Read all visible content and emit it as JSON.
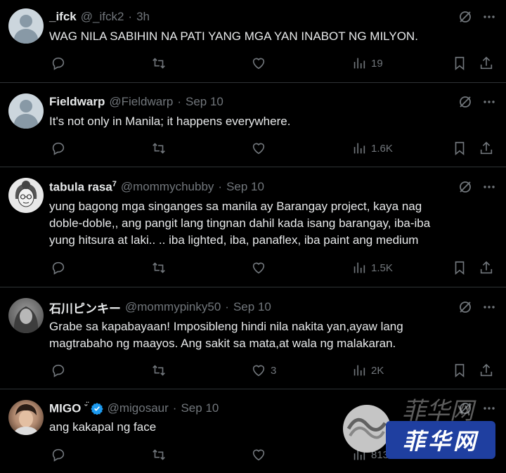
{
  "tweets": [
    {
      "name": "_ifck",
      "name_sup": "",
      "handle": "@_ifck2",
      "time": "3h",
      "verified": false,
      "avatar": "default-avatar",
      "lines": [
        "WAG NILA SABIHIN NA PATI YANG MGA YAN INABOT NG MILYON."
      ],
      "replies": "",
      "retweets": "",
      "likes": "",
      "views": "19"
    },
    {
      "name": "Fieldwarp",
      "name_sup": "",
      "handle": "@Fieldwarp",
      "time": "Sep 10",
      "verified": false,
      "avatar": "default-avatar",
      "lines": [
        "It's not only in Manila; it happens everywhere."
      ],
      "replies": "",
      "retweets": "",
      "likes": "",
      "views": "1.6K"
    },
    {
      "name": "tabula rasa",
      "name_sup": "7",
      "handle": "@mommychubby",
      "time": "Sep 10",
      "verified": false,
      "avatar": "sketch-portrait-avatar",
      "lines": [
        "yung bagong mga singanges sa manila ay Barangay project, kaya nag",
        "doble-doble,, ang pangit lang tingnan dahil kada isang barangay, iba-iba",
        "yung hitsura at laki.. .. iba lighted, iba, panaflex, iba paint ang medium"
      ],
      "replies": "",
      "retweets": "",
      "likes": "",
      "views": "1.5K"
    },
    {
      "name": "石川ピンキー",
      "name_sup": "",
      "handle": "@mommypinky50",
      "time": "Sep 10",
      "verified": false,
      "avatar": "grayscale-photo-avatar",
      "lines": [
        "Grabe sa kapabayaan! Imposibleng hindi nila nakita yan,ayaw lang",
        "magtrabaho ng maayos. Ang sakit sa mata,at wala ng malakaran."
      ],
      "replies": "",
      "retweets": "",
      "likes": "3",
      "views": "2K"
    },
    {
      "name": "MIGO",
      "name_sup": "ᵕ̈",
      "handle": "@migosaur",
      "time": "Sep 10",
      "verified": true,
      "avatar": "photo-avatar",
      "lines": [
        "ang kakapal ng face"
      ],
      "replies": "",
      "retweets": "",
      "likes": "",
      "views": "813"
    }
  ],
  "watermark": {
    "text": "菲华网"
  },
  "colors": {
    "background": "#000000",
    "text": "#e7e9ea",
    "muted": "#71767b",
    "divider": "#2f3336",
    "verified": "#1d9bf0"
  }
}
